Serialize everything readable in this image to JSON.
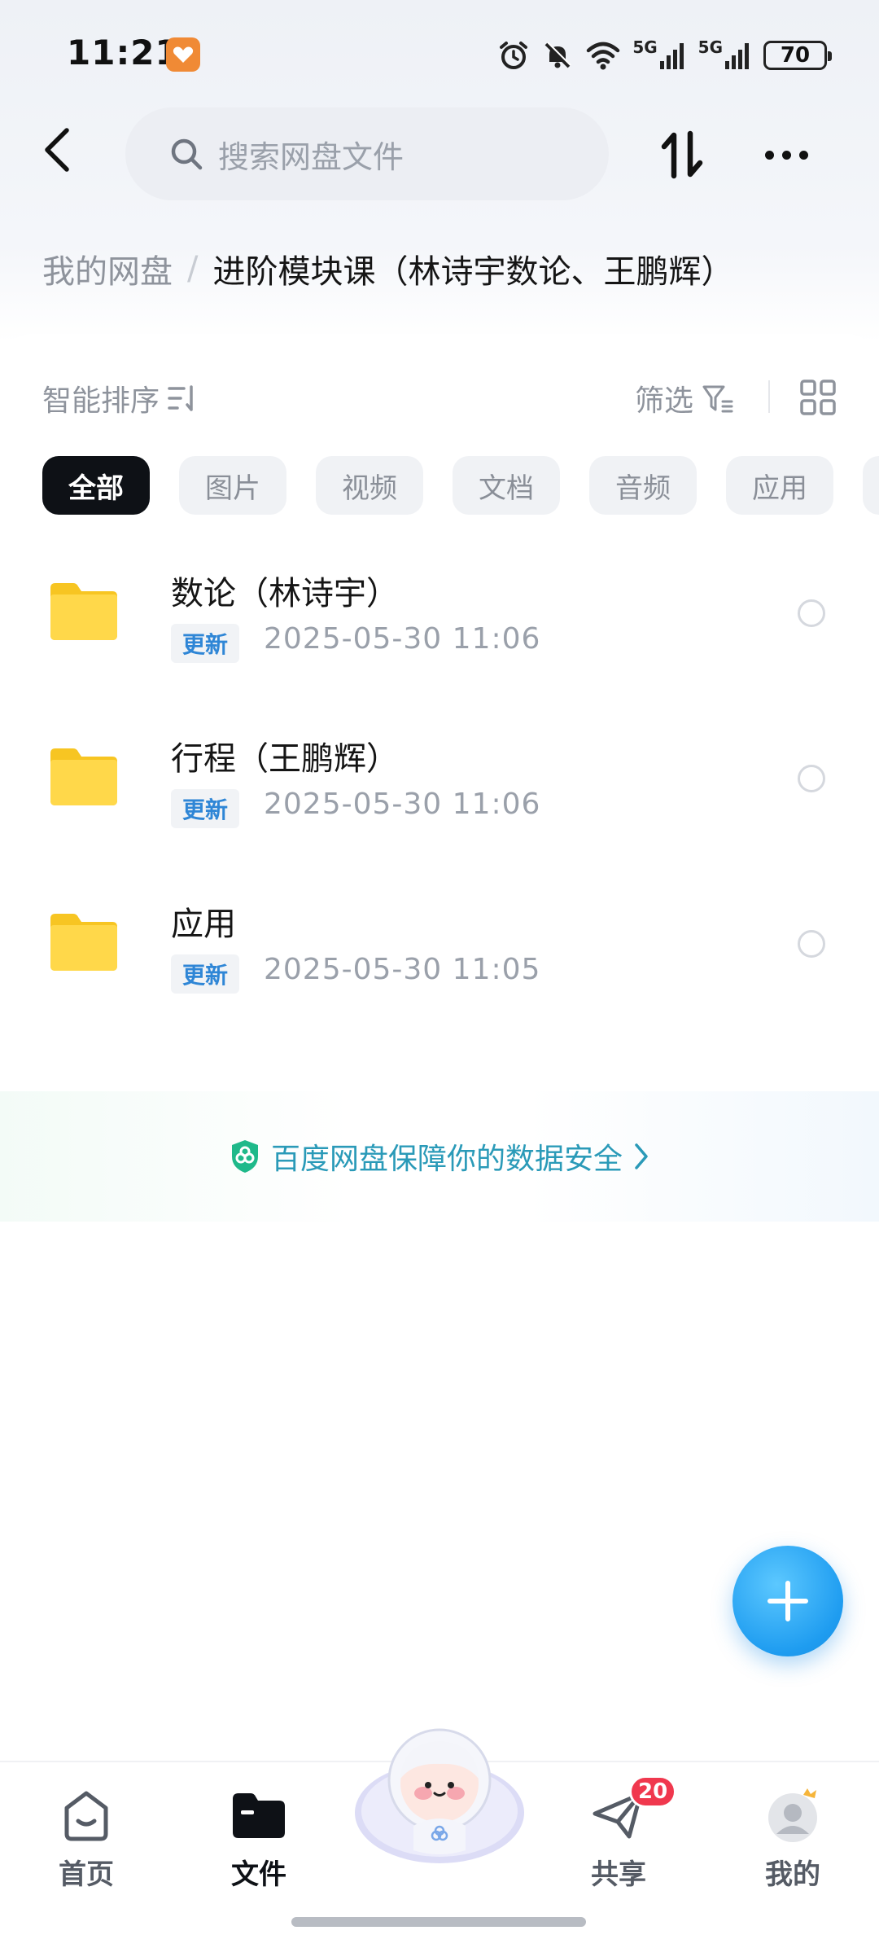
{
  "status_bar": {
    "time": "11:21",
    "network_1": "5G",
    "network_2": "5G",
    "battery": "70"
  },
  "top_bar": {
    "search_placeholder": "搜索网盘文件"
  },
  "breadcrumb": {
    "root": "我的网盘",
    "separator": "/",
    "current": "进阶模块课（林诗宇数论、王鹏辉）"
  },
  "toolbar": {
    "sort_label": "智能排序",
    "filter_label": "筛选"
  },
  "categories": [
    {
      "label": "全部",
      "active": true
    },
    {
      "label": "图片",
      "active": false
    },
    {
      "label": "视频",
      "active": false
    },
    {
      "label": "文档",
      "active": false
    },
    {
      "label": "音频",
      "active": false
    },
    {
      "label": "应用",
      "active": false
    }
  ],
  "files": [
    {
      "name": "数论（林诗宇）",
      "badge": "更新",
      "time": "2025-05-30  11:06"
    },
    {
      "name": "行程（王鹏辉）",
      "badge": "更新",
      "time": "2025-05-30  11:06"
    },
    {
      "name": "应用",
      "badge": "更新",
      "time": "2025-05-30  11:05"
    }
  ],
  "security_banner": {
    "text": "百度网盘保障你的数据安全"
  },
  "bottom_nav": {
    "home": "首页",
    "files": "文件",
    "share": "共享",
    "share_badge": "20",
    "mine": "我的"
  },
  "colors": {
    "accent": "#1e9cf0",
    "badge_text": "#2f86d6",
    "security": "#2a9ab8",
    "folder": "#ffd23f",
    "share_badge": "#f0384e"
  }
}
